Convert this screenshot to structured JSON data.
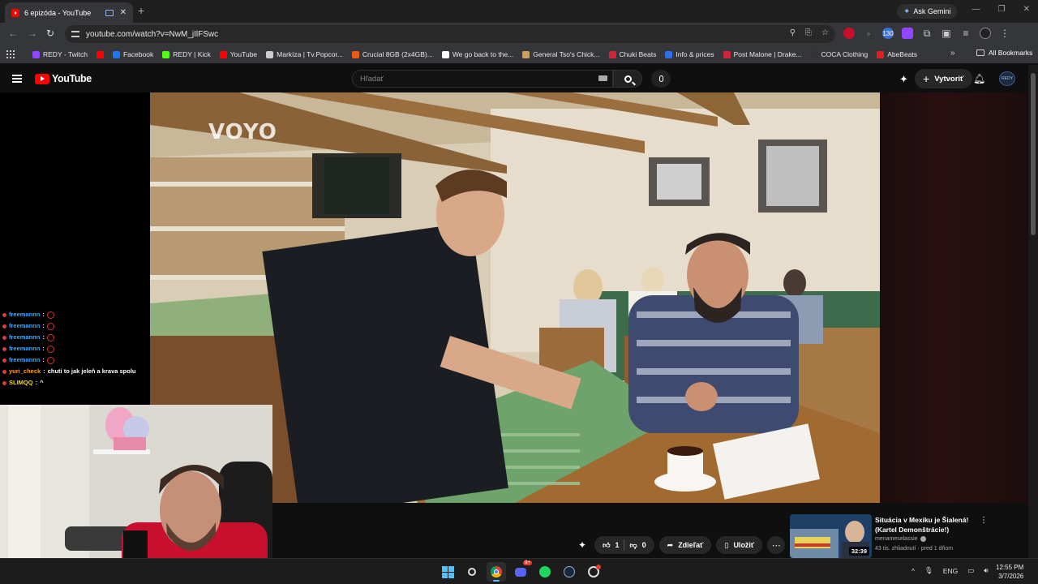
{
  "browser": {
    "tab_title": "6 epizóda - YouTube",
    "ask_gemini": "Ask Gemini",
    "url": "youtube.com/watch?v=NwM_jIlFSwc",
    "extension_badge": "130",
    "bookmarks": [
      {
        "label": "REDY - Twitch",
        "color": "#9146ff"
      },
      {
        "label": "",
        "color": "#ff0000"
      },
      {
        "label": "Facebook",
        "color": "#1877f2"
      },
      {
        "label": "REDY | Kick",
        "color": "#53fc18"
      },
      {
        "label": "YouTube",
        "color": "#ff0000"
      },
      {
        "label": "Markíza | Tv.Popcor...",
        "color": "#cccccc"
      },
      {
        "label": "Crucial 8GB (2x4GB)...",
        "color": "#e8591a"
      },
      {
        "label": "We go back to the...",
        "color": "#ffffff"
      },
      {
        "label": "General Tso's Chick...",
        "color": "#c8a060"
      },
      {
        "label": "Chuki Beats",
        "color": "#d0243c"
      },
      {
        "label": "Info & prices",
        "color": "#2e6ee6"
      },
      {
        "label": "Post Malone | Drake...",
        "color": "#d0243c"
      },
      {
        "label": "COCA Clothing",
        "color": "#333333"
      },
      {
        "label": "AbeBeats",
        "color": "#e02020"
      }
    ],
    "all_bookmarks": "All Bookmarks"
  },
  "youtube": {
    "logo_text": "YouTube",
    "search_placeholder": "Hľadať",
    "create_label": "Vytvoriť",
    "avatar_text": "REDY"
  },
  "video": {
    "watermark": "VOYO"
  },
  "chat": [
    {
      "user": "freemannn",
      "text": "",
      "color": "#3ea6ff",
      "emote": true
    },
    {
      "user": "freemannn",
      "text": "",
      "color": "#3ea6ff",
      "emote": true
    },
    {
      "user": "freemannn",
      "text": "",
      "color": "#3ea6ff",
      "emote": true
    },
    {
      "user": "freemannn",
      "text": "",
      "color": "#3ea6ff",
      "emote": true
    },
    {
      "user": "freemannn",
      "text": "",
      "color": "#3ea6ff",
      "emote": true
    },
    {
      "user": "yuri_check",
      "text": "chuti to jak jeleň a krava spolu",
      "color": "#ff9f1a",
      "emote": false
    },
    {
      "user": "SLIMQQ",
      "text": "^",
      "color": "#ffd700",
      "emote": false
    }
  ],
  "actions": {
    "likes": "1",
    "dislikes": "0",
    "share": "Zdieľať",
    "save": "Uložiť"
  },
  "recommended": {
    "title": "Situácia v Mexiku je Šialená! (Kartel Demonštrácie!)",
    "channel": "menameselassie",
    "meta": "43 tis. zhliadnutí · pred 1 dňom",
    "duration": "32:39"
  },
  "taskbar": {
    "lang": "ENG",
    "time": "12:55 PM",
    "date": "3/7/2026",
    "discord_badge": "9+"
  }
}
